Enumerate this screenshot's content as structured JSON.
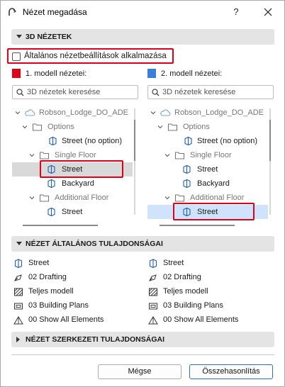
{
  "window": {
    "title": "Nézet megadása",
    "help_label": "?"
  },
  "section_3d": {
    "title": "3D NÉZETEK"
  },
  "global_option": {
    "label": "Általános nézetbeállítások alkalmazása",
    "checked": false
  },
  "model1": {
    "header": "1. modell nézetei:",
    "color": "#e0001a",
    "search_placeholder": "3D nézetek keresése",
    "tree": {
      "root": "Robson_Lodge_DO_ADE",
      "options_folder": "Options",
      "street_no_option": "Street (no option)",
      "single_floor_folder": "Single Floor",
      "street": "Street",
      "backyard": "Backyard",
      "additional_floor_folder": "Additional Floor",
      "street_additional": "Street"
    },
    "selected_item": "Street"
  },
  "model2": {
    "header": "2. modell nézetei:",
    "color": "#3d7fd6",
    "search_placeholder": "3D nézetek keresése",
    "tree": {
      "root": "Robson_Lodge_DO_ADE",
      "options_folder": "Options",
      "street_no_option": "Street (no option)",
      "single_floor_folder": "Single Floor",
      "street": "Street",
      "backyard": "Backyard",
      "additional_floor_folder": "Additional Floor",
      "street_additional": "Street"
    },
    "selected_item": "Street"
  },
  "section_general": {
    "title": "NÉZET ÁLTALÁNOS TULAJDONSÁGAI"
  },
  "properties_left": {
    "view_name": "Street",
    "drafting": "02 Drafting",
    "model_filter": "Teljes modell",
    "plan_set": "03 Building Plans",
    "layer_combo": "00 Show All Elements"
  },
  "properties_right": {
    "view_name": "Street",
    "drafting": "02 Drafting",
    "model_filter": "Teljes modell",
    "plan_set": "03 Building Plans",
    "layer_combo": "00 Show All Elements"
  },
  "section_structural": {
    "title": "NÉZET SZERKEZETI TULAJDONSÁGAI"
  },
  "buttons": {
    "cancel": "Mégse",
    "compare": "Összehasonlítás"
  }
}
